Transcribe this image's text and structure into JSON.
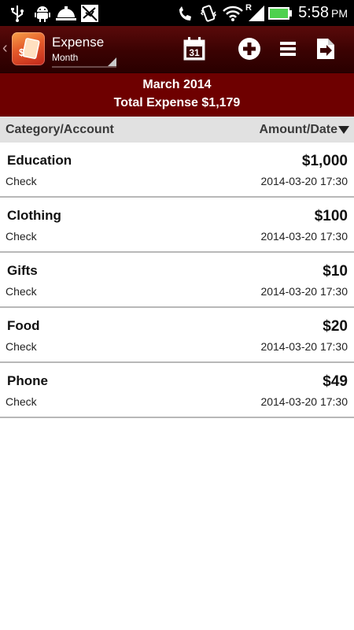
{
  "status_bar": {
    "time": "5:58",
    "ampm": "PM",
    "icons": [
      "usb-icon",
      "android-debug-icon",
      "service-bell-icon",
      "muted-bird-icon",
      "phone-icon",
      "vibrate-icon",
      "wifi-icon",
      "roaming-signal-icon",
      "battery-icon"
    ],
    "roaming_letter": "R",
    "battery_color": "#4fd14f"
  },
  "action_bar": {
    "title": "Expense",
    "subtitle": "Month",
    "calendar_day": "31",
    "buttons": [
      "calendar-icon",
      "add-icon",
      "list-menu-icon",
      "export-icon"
    ],
    "background": "#3a0202"
  },
  "summary": {
    "period": "March 2014",
    "total": "Total Expense $1,179",
    "background": "#6e0000"
  },
  "list_header": {
    "left": "Category/Account",
    "right": "Amount/Date"
  },
  "expenses": [
    {
      "category": "Education",
      "account": "Check",
      "amount": "$1,000",
      "date": "2014-03-20 17:30"
    },
    {
      "category": "Clothing",
      "account": "Check",
      "amount": "$100",
      "date": "2014-03-20 17:30"
    },
    {
      "category": "Gifts",
      "account": "Check",
      "amount": "$10",
      "date": "2014-03-20 17:30"
    },
    {
      "category": "Food",
      "account": "Check",
      "amount": "$20",
      "date": "2014-03-20 17:30"
    },
    {
      "category": "Phone",
      "account": "Check",
      "amount": "$49",
      "date": "2014-03-20 17:30"
    }
  ]
}
